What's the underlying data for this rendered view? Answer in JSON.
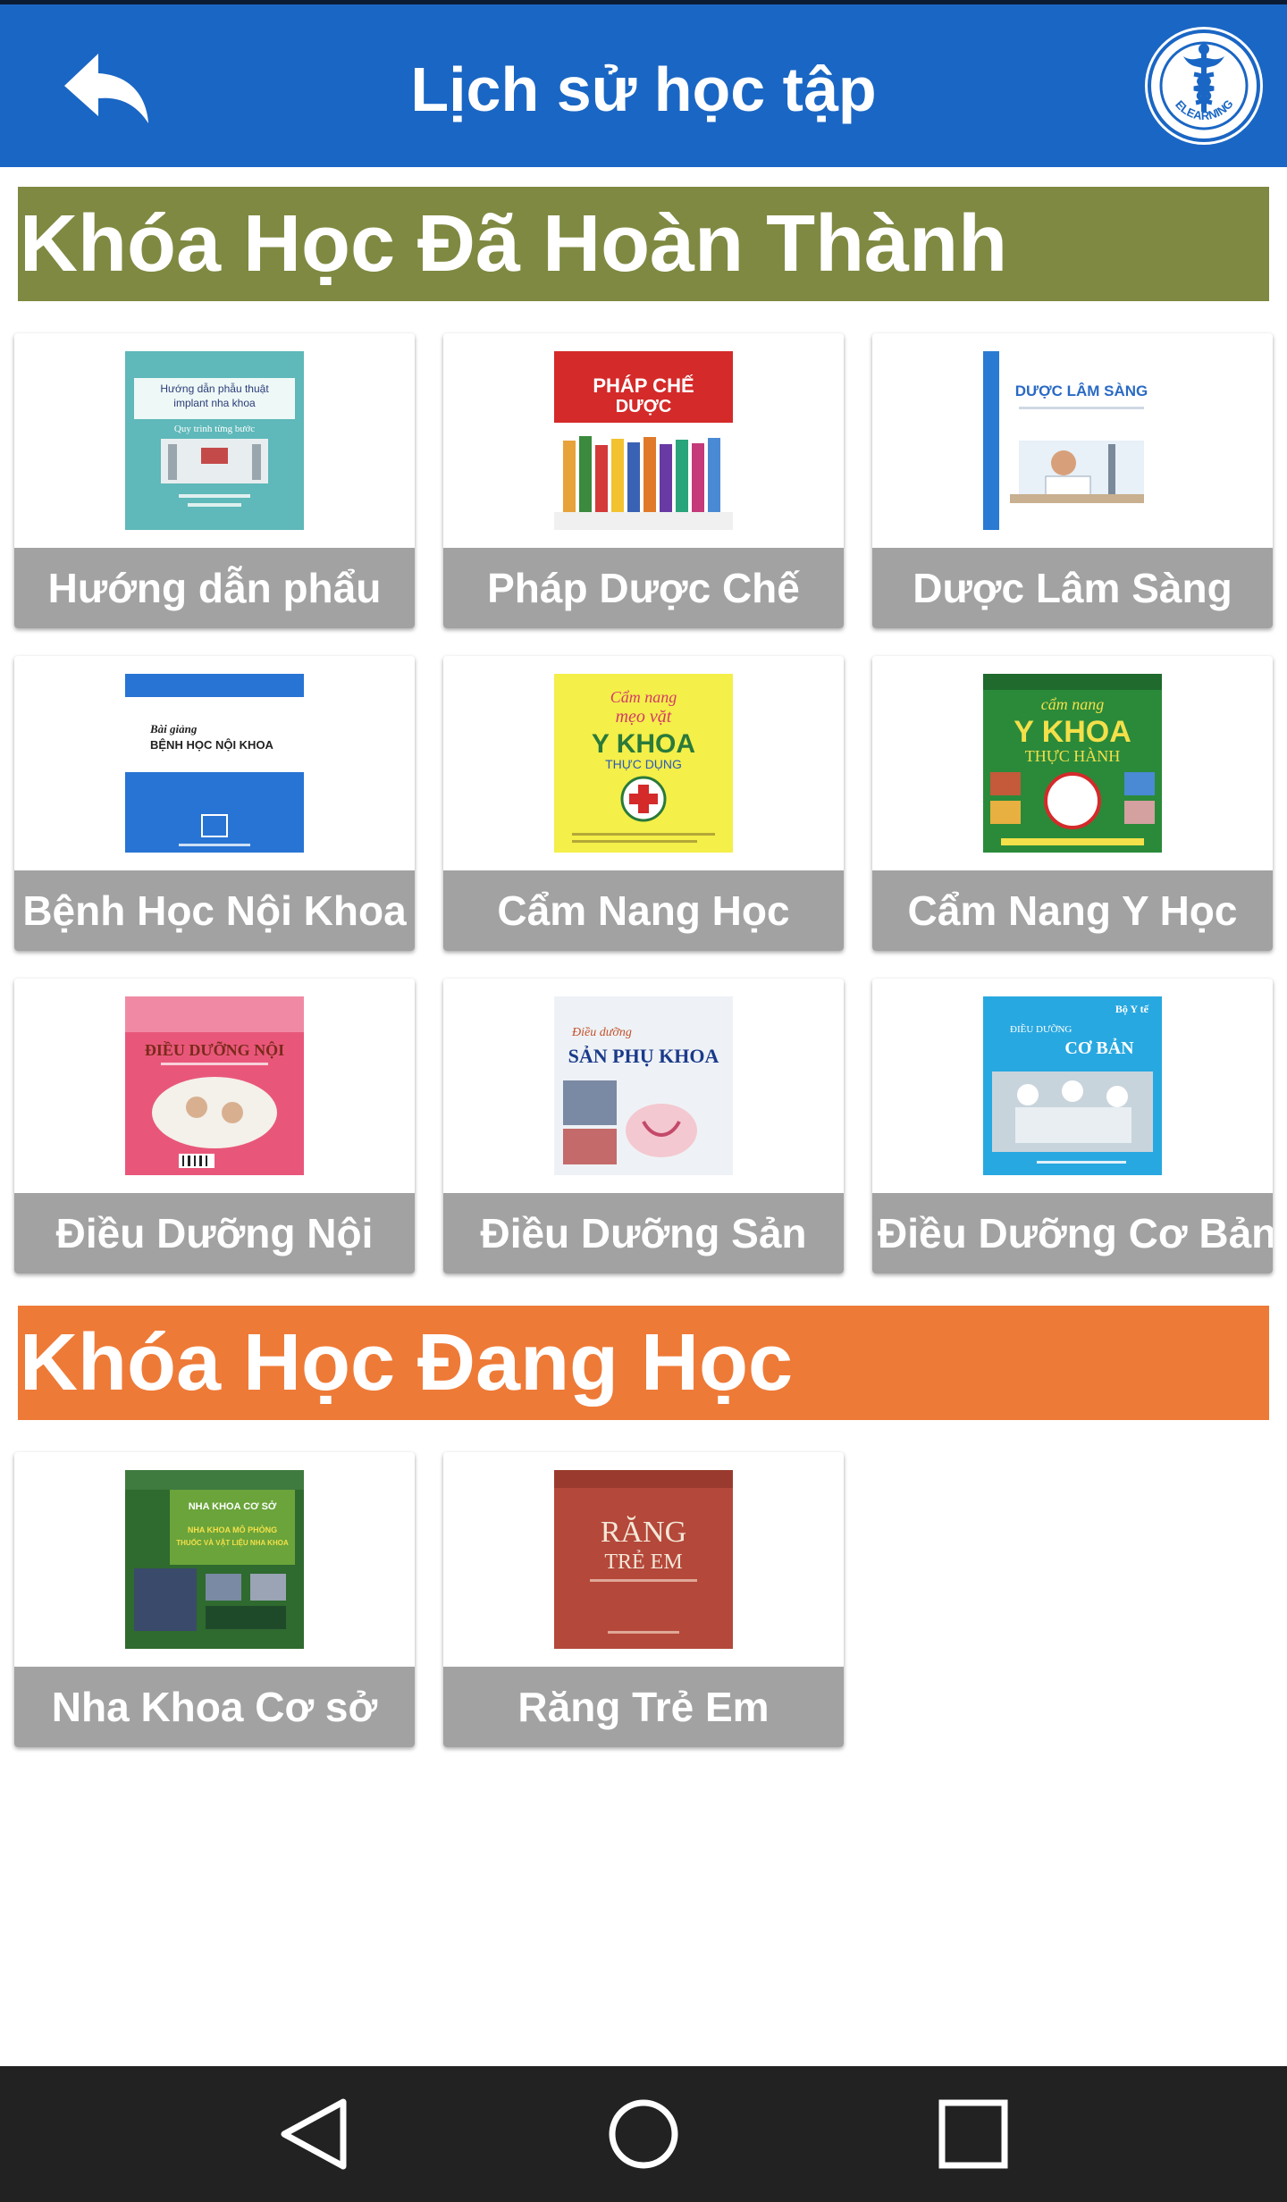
{
  "header": {
    "title": "Lịch sử học tập",
    "back_icon": "back-arrow-icon",
    "logo_text": "ELEARNING",
    "color": "#1a66c4"
  },
  "sections": {
    "completed": {
      "title": "Khóa Học Đã Hoàn Thành",
      "color": "#7f8941",
      "courses": [
        {
          "label": "Hướng dẫn phẩu",
          "cover_color": "#5fb8b9",
          "cover_lines": [
            "Hướng dẫn phẫu thuật",
            "implant nha khoa",
            "Quy trình từng bước"
          ]
        },
        {
          "label": "Pháp Dược Chế",
          "cover_color": "#d42a2a",
          "cover_lines": [
            "PHÁP CHẾ",
            "DƯỢC"
          ]
        },
        {
          "label": "Dược Lâm Sàng",
          "cover_color": "#ffffff",
          "cover_lines": [
            "DƯỢC LÂM SÀNG"
          ]
        },
        {
          "label": "Bệnh Học Nội Khoa",
          "cover_color": "#2874d4",
          "cover_lines": [
            "Bài giảng",
            "BỆNH HỌC NỘI KHOA"
          ]
        },
        {
          "label": "Cẩm Nang Học",
          "cover_color": "#f4ef49",
          "cover_lines": [
            "Cẩm nang",
            "mẹo vặt",
            "Y KHOA",
            "THỰC DỤNG"
          ]
        },
        {
          "label": "Cẩm Nang Y Học",
          "cover_color": "#2a8a3a",
          "cover_lines": [
            "cẩm nang",
            "Y KHOA",
            "THỰC HÀNH"
          ]
        },
        {
          "label": "Điều Dưỡng Nội",
          "cover_color": "#e8577a",
          "cover_lines": [
            "ĐIỀU DƯỠNG NỘI"
          ]
        },
        {
          "label": "Điều Dưỡng Sản",
          "cover_color": "#eef2f6",
          "cover_lines": [
            "Điều dưỡng",
            "SẢN PHỤ KHOA"
          ]
        },
        {
          "label": "Điều Dưỡng Cơ Bản",
          "cover_color": "#28a8e0",
          "cover_lines": [
            "Bộ Y tế",
            "ĐIỀU DƯỠNG",
            "CƠ BẢN"
          ]
        }
      ]
    },
    "in_progress": {
      "title": "Khóa Học Đang Học",
      "color": "#ee7a37",
      "courses": [
        {
          "label": "Nha Khoa Cơ sở",
          "cover_color": "#2f6a2f",
          "cover_lines": [
            "NHA KHOA CƠ SỞ",
            "NHA KHOA MÔ PHỎNG",
            "THUỐC VÀ VẬT LIỆU NHA KHOA"
          ]
        },
        {
          "label": "Răng Trẻ Em",
          "cover_color": "#b4483a",
          "cover_lines": [
            "RĂNG",
            "TRẺ EM"
          ]
        }
      ]
    }
  },
  "nav_bar": {
    "back_icon": "triangle-back-icon",
    "home_icon": "circle-home-icon",
    "recents_icon": "square-recents-icon"
  }
}
